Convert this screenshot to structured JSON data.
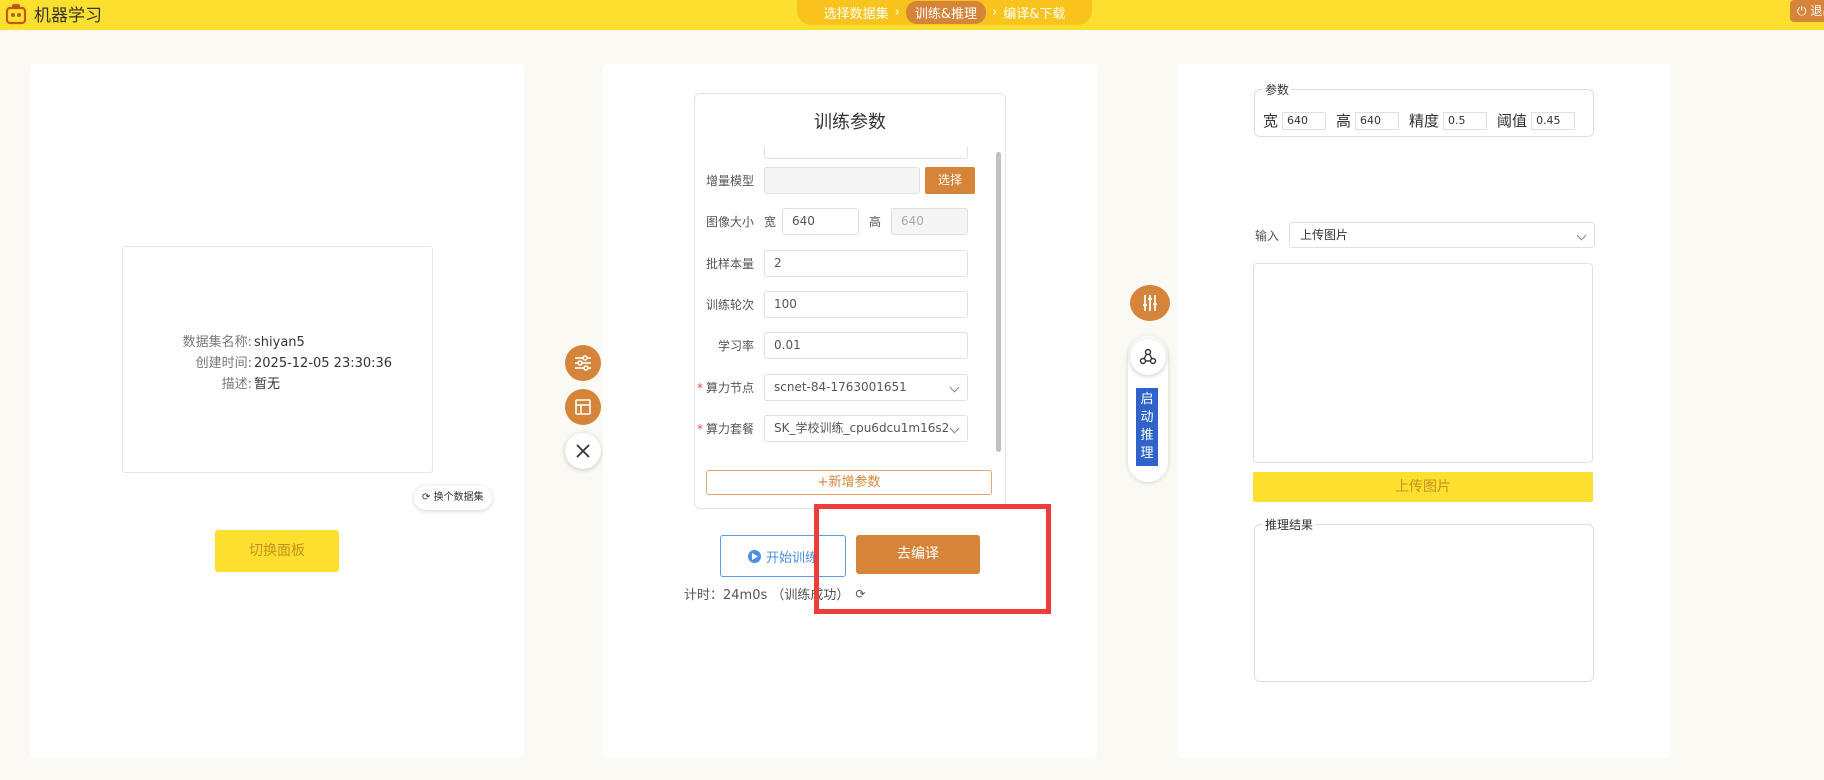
{
  "header": {
    "app_title": "机器学习",
    "steps": [
      "选择数据集",
      "训练&推理",
      "编译&下载"
    ],
    "exit_label": "退出"
  },
  "dataset": {
    "rows": [
      {
        "label": "数据集名称:",
        "value": "shiyan5"
      },
      {
        "label": "创建时间:",
        "value": "2025-12-05 23:30:36"
      },
      {
        "label": "描述:",
        "value": "暂无"
      }
    ],
    "switch_dataset_label": "换个数据集",
    "switch_panel_label": "切换面板"
  },
  "train": {
    "title": "训练参数",
    "incremental_model_label": "增量模型",
    "choose_label": "选择",
    "image_size_label": "图像大小",
    "width_label": "宽",
    "width_value": "640",
    "height_label": "高",
    "height_value": "640",
    "batch_label": "批样本量",
    "batch_value": "2",
    "epochs_label": "训练轮次",
    "epochs_value": "100",
    "lr_label": "学习率",
    "lr_value": "0.01",
    "node_label": "算力节点",
    "node_value": "scnet-84-1763001651",
    "package_label": "算力套餐",
    "package_value": "SK_学校训练_cpu6dcu1m16s2",
    "add_param_label": "+新增参数",
    "start_label": "开始训练",
    "compile_label": "去编译",
    "timer_text": "计时：24m0s （训练成功）"
  },
  "inference": {
    "params_legend": "参数",
    "width_label": "宽",
    "width_value": "640",
    "height_label": "高",
    "height_value": "640",
    "precision_label": "精度",
    "precision_value": "0.5",
    "threshold_label": "阈值",
    "threshold_value": "0.45",
    "input_label": "输入",
    "input_value": "上传图片",
    "upload_label": "上传图片",
    "result_legend": "推理结果",
    "start_infer_label": "启动推理"
  },
  "colors": {
    "yellow": "#fde02f",
    "orange": "#d5843a",
    "blue": "#2f63c9",
    "highlight": "#ee3d3d"
  }
}
